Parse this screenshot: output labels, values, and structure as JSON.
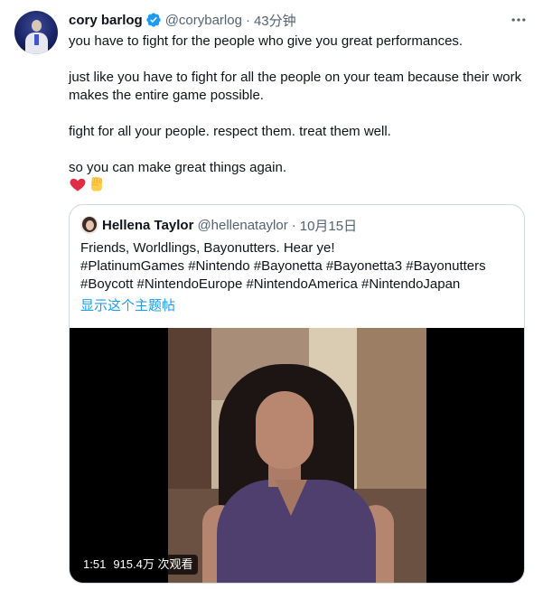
{
  "tweet": {
    "author_name": "cory barlog",
    "handle": "@corybarlog",
    "separator": "·",
    "time": "43分钟",
    "paragraphs": [
      "you have to fight for the people who give you great performances.",
      "just like you have to fight for all the people on your team because their work makes the entire game possible.",
      "fight for all your people. respect them.  treat them well.",
      "so you can make great things again."
    ],
    "emojis": [
      "heart-emoji",
      "raised-fist-emoji"
    ],
    "more_icon": "more-horizontal-icon",
    "verified_icon": "verified-badge-icon"
  },
  "quote": {
    "author_name": "Hellena Taylor",
    "handle": "@hellenataylor",
    "separator": "·",
    "time": "10月15日",
    "lines": [
      "Friends, Worldlings, Bayonutters. Hear ye!",
      "#PlatinumGames #Nintendo #Bayonetta #Bayonetta3 #Bayonutters",
      "#Boycott #NintendoEurope #NintendoAmerica #NintendoJapan"
    ],
    "show_thread_label": "显示这个主题帖",
    "video": {
      "duration": "1:51",
      "views": "915.4万 次观看"
    }
  },
  "colors": {
    "text": "#0f1419",
    "muted": "#536471",
    "link": "#1d9bf0",
    "border": "#cfd9de",
    "verified": "#1d9bf0"
  }
}
